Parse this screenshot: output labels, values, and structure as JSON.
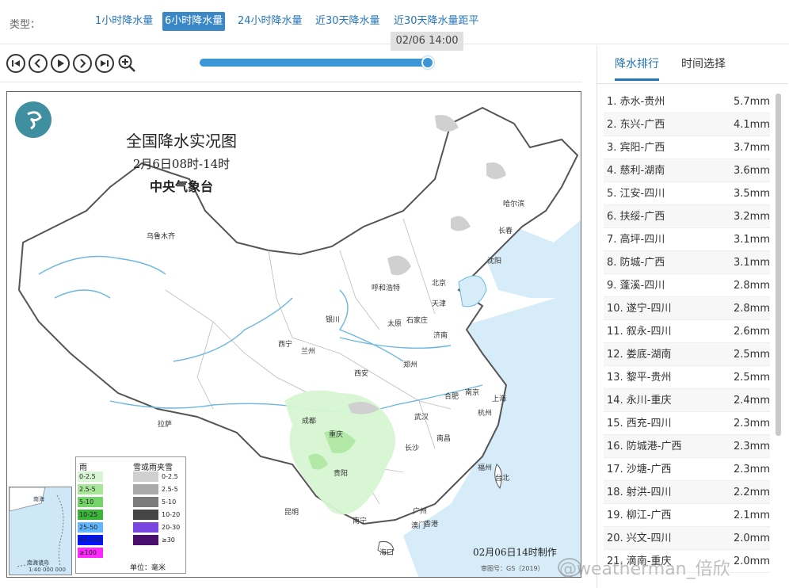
{
  "typebar": {
    "label": "类型：",
    "tabs": [
      {
        "label": "1小时降水量",
        "active": false
      },
      {
        "label": "6小时降水量",
        "active": true
      },
      {
        "label": "24小时降水量",
        "active": false
      },
      {
        "label": "近30天降水量",
        "active": false
      },
      {
        "label": "近30天降水量距平",
        "active": false
      }
    ]
  },
  "player": {
    "time_tooltip": "02/06 14:00",
    "progress": 1.0,
    "buttons": [
      "skip-start-icon",
      "prev-icon",
      "play-icon",
      "next-icon",
      "skip-end-icon",
      "zoom-in-icon"
    ]
  },
  "map": {
    "title": "全国降水实况图",
    "subtitle": "2月6日08时-14时",
    "agency": "中央气象台",
    "made_at": "02月06日14时制作",
    "approval": "审图号：GS（2019）",
    "cities": [
      "乌鲁木齐",
      "哈尔滨",
      "长春",
      "沈阳",
      "呼和浩特",
      "北京",
      "天津",
      "银川",
      "太原",
      "石家庄",
      "西宁",
      "兰州",
      "济南",
      "郑州",
      "西安",
      "南京",
      "合肥",
      "上海",
      "成都",
      "武汉",
      "杭州",
      "重庆",
      "拉萨",
      "长沙",
      "南昌",
      "贵阳",
      "福州",
      "台北",
      "昆明",
      "南宁",
      "广州",
      "澳门",
      "香港",
      "海口"
    ],
    "inset_labels": [
      "南海诸岛",
      "南海",
      "1:40 000 000"
    ],
    "legend": {
      "rain_header": "雨",
      "snow_header": "雪或雨夹雪",
      "rain": [
        {
          "label": "0-2.5",
          "color": "#d7f5d2"
        },
        {
          "label": "2.5-5",
          "color": "#a8e69a"
        },
        {
          "label": "5-10",
          "color": "#74d46a"
        },
        {
          "label": "10-25",
          "color": "#3cb43a"
        },
        {
          "label": "25-50",
          "color": "#62b8ff"
        },
        {
          "label": "50-100",
          "color": "#0016ff"
        },
        {
          "label": "≥100",
          "color": "#ff26ff"
        }
      ],
      "snow": [
        {
          "label": "0-2.5",
          "color": "#d0d0d0"
        },
        {
          "label": "2.5-5",
          "color": "#aaaaaa"
        },
        {
          "label": "5-10",
          "color": "#7c7c7c"
        },
        {
          "label": "10-20",
          "color": "#454545"
        },
        {
          "label": "20-30",
          "color": "#7b45e0"
        },
        {
          "label": "≥30",
          "color": "#4a0f6e"
        }
      ],
      "unit": "单位：毫米"
    }
  },
  "panel": {
    "tabs": [
      {
        "label": "降水排行",
        "active": true
      },
      {
        "label": "时间选择",
        "active": false
      }
    ],
    "ranking": [
      {
        "name": "1. 赤水-贵州",
        "value": "5.7mm"
      },
      {
        "name": "2. 东兴-广西",
        "value": "4.1mm"
      },
      {
        "name": "3. 宾阳-广西",
        "value": "3.7mm"
      },
      {
        "name": "4. 慈利-湖南",
        "value": "3.6mm"
      },
      {
        "name": "5. 江安-四川",
        "value": "3.5mm"
      },
      {
        "name": "6. 扶绥-广西",
        "value": "3.2mm"
      },
      {
        "name": "7. 高坪-四川",
        "value": "3.1mm"
      },
      {
        "name": "8. 防城-广西",
        "value": "3.1mm"
      },
      {
        "name": "9. 蓬溪-四川",
        "value": "2.8mm"
      },
      {
        "name": "10. 遂宁-四川",
        "value": "2.8mm"
      },
      {
        "name": "11. 叙永-四川",
        "value": "2.6mm"
      },
      {
        "name": "12. 娄底-湖南",
        "value": "2.5mm"
      },
      {
        "name": "13. 黎平-贵州",
        "value": "2.5mm"
      },
      {
        "name": "14. 永川-重庆",
        "value": "2.4mm"
      },
      {
        "name": "15. 西充-四川",
        "value": "2.3mm"
      },
      {
        "name": "16. 防城港-广西",
        "value": "2.3mm"
      },
      {
        "name": "17. 沙塘-广西",
        "value": "2.3mm"
      },
      {
        "name": "18. 射洪-四川",
        "value": "2.2mm"
      },
      {
        "name": "19. 柳江-广西",
        "value": "2.1mm"
      },
      {
        "name": "20. 兴文-四川",
        "value": "2.0mm"
      },
      {
        "name": "21. 滴南-重庆",
        "value": "2.0mm"
      }
    ]
  },
  "watermark": "@weatherman_倍欣"
}
